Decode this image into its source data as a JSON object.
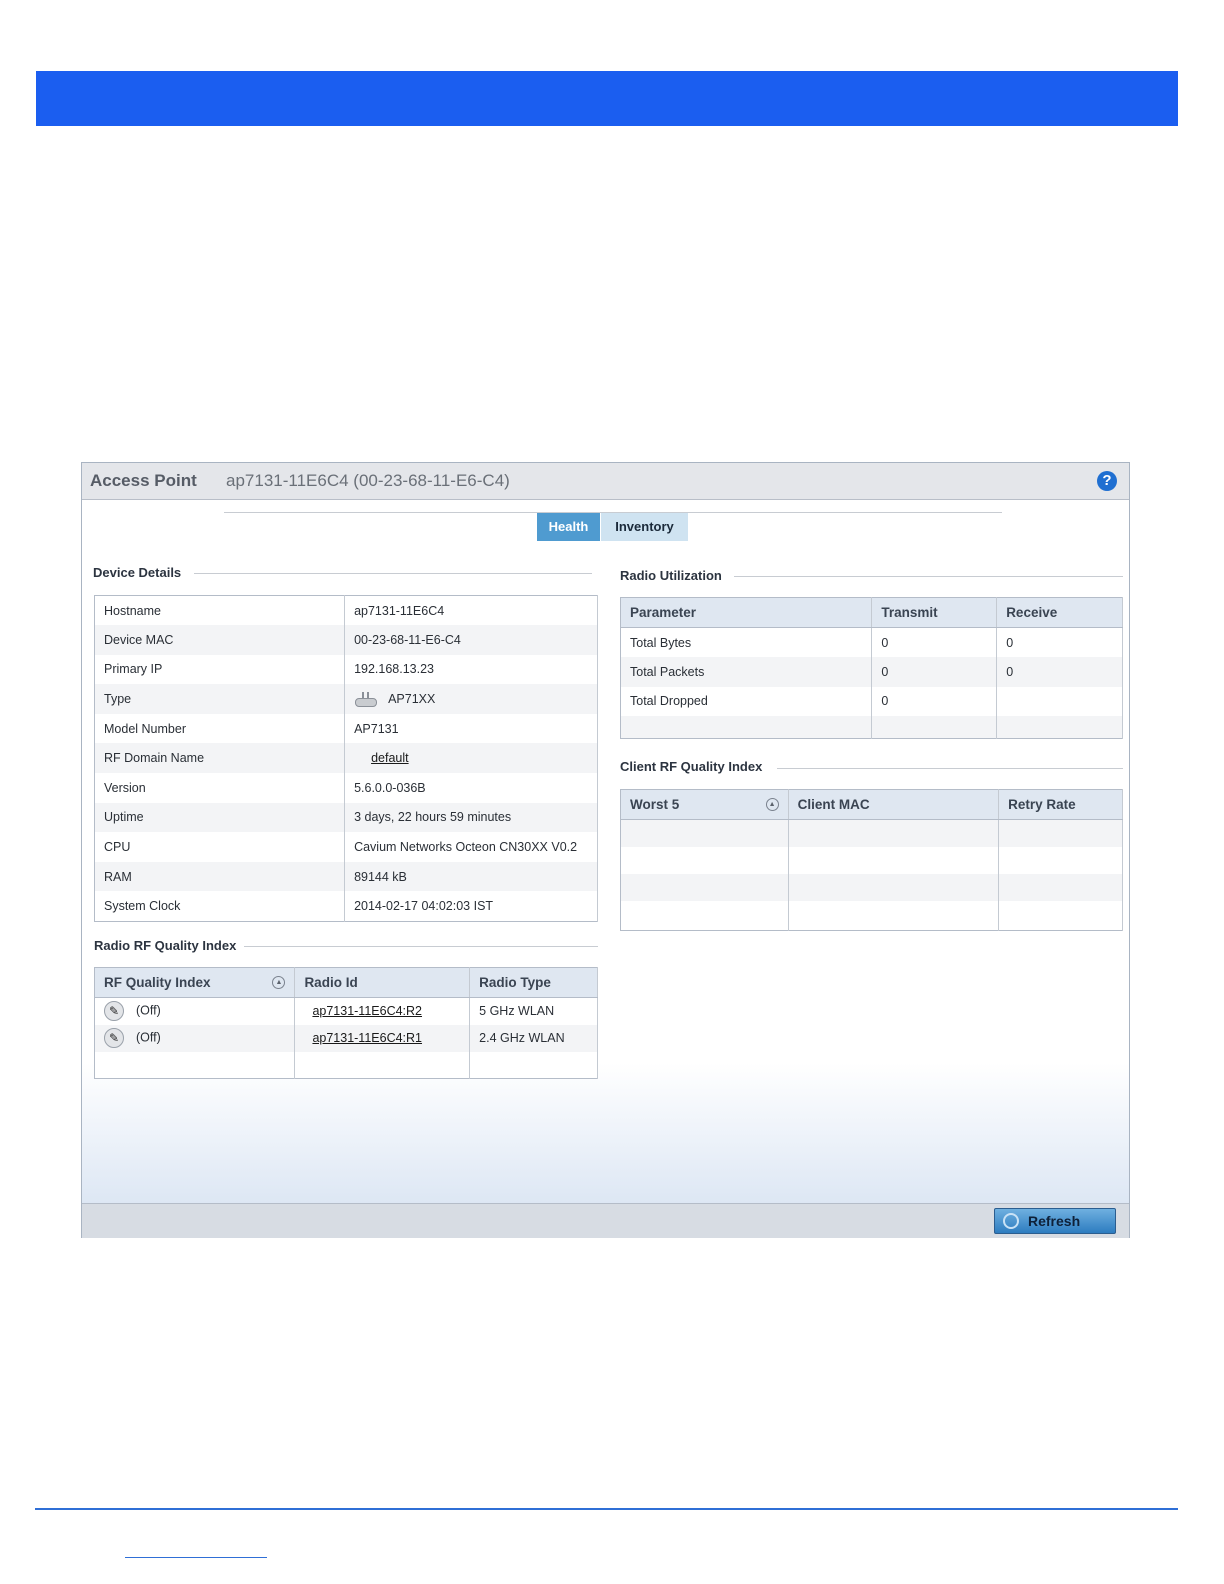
{
  "panel": {
    "title": "Access Point",
    "subtitle": "ap7131-11E6C4 (00-23-68-11-E6-C4)",
    "help_icon": "?"
  },
  "tabs": [
    {
      "label": "Health",
      "active": true
    },
    {
      "label": "Inventory",
      "active": false
    }
  ],
  "device_details": {
    "title": "Device Details",
    "rows": [
      {
        "label": "Hostname",
        "value": "ap7131-11E6C4"
      },
      {
        "label": "Device MAC",
        "value": "00-23-68-11-E6-C4"
      },
      {
        "label": "Primary IP",
        "value": "192.168.13.23"
      },
      {
        "label": "Type",
        "value": "AP71XX"
      },
      {
        "label": "Model Number",
        "value": "AP7131"
      },
      {
        "label": "RF Domain Name",
        "value": "default"
      },
      {
        "label": "Version",
        "value": "5.6.0.0-036B"
      },
      {
        "label": "Uptime",
        "value": "3 days, 22 hours 59 minutes"
      },
      {
        "label": "CPU",
        "value": "Cavium Networks Octeon CN30XX V0.2"
      },
      {
        "label": "RAM",
        "value": "89144 kB"
      },
      {
        "label": "System Clock",
        "value": "2014-02-17 04:02:03 IST"
      }
    ]
  },
  "radio_rf_quality": {
    "title": "Radio RF Quality Index",
    "headers": [
      "RF Quality Index",
      "Radio Id",
      "Radio Type"
    ],
    "rows": [
      {
        "quality": "(Off)",
        "radio_id": "ap7131-11E6C4:R2",
        "radio_type": "5 GHz WLAN"
      },
      {
        "quality": "(Off)",
        "radio_id": "ap7131-11E6C4:R1",
        "radio_type": "2.4 GHz WLAN"
      }
    ]
  },
  "radio_utilization": {
    "title": "Radio Utilization",
    "headers": [
      "Parameter",
      "Transmit",
      "Receive"
    ],
    "rows": [
      {
        "parameter": "Total Bytes",
        "transmit": "0",
        "receive": "0"
      },
      {
        "parameter": "Total Packets",
        "transmit": "0",
        "receive": "0"
      },
      {
        "parameter": "Total Dropped",
        "transmit": "0",
        "receive": ""
      }
    ]
  },
  "client_rf_quality": {
    "title": "Client RF Quality Index",
    "headers": [
      "Worst 5",
      "Client MAC",
      "Retry Rate"
    ]
  },
  "footer": {
    "refresh_label": "Refresh"
  }
}
